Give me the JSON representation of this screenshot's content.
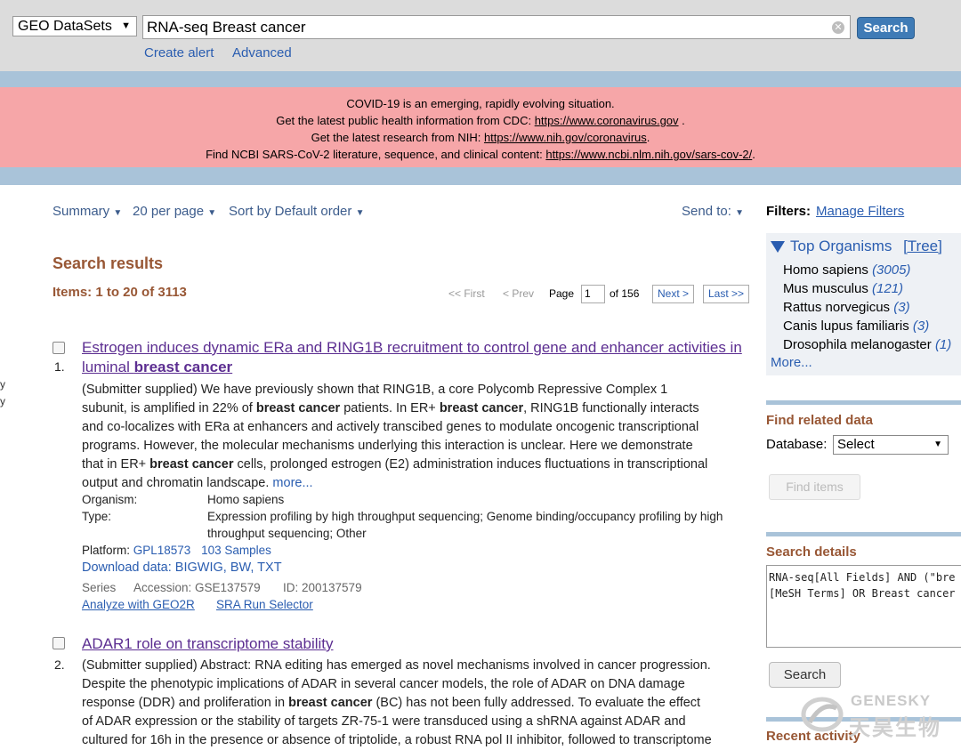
{
  "topbar": {
    "database": "GEO DataSets",
    "query": "RNA-seq Breast cancer",
    "clear_glyph": "✕",
    "search_label": "Search",
    "create_alert": "Create alert",
    "advanced": "Advanced"
  },
  "covid": {
    "line1": "COVID-19 is an emerging, rapidly evolving situation.",
    "line2_text": "Get the latest public health information from CDC: ",
    "line2_link": "https://www.coronavirus.gov",
    "line2_end": " .",
    "line3_text": "Get the latest research from NIH: ",
    "line3_link": "https://www.nih.gov/coronavirus",
    "line3_end": ".",
    "line4_text": "Find NCBI SARS-CoV-2 literature, sequence, and clinical content: ",
    "line4_link": "https://www.ncbi.nlm.nih.gov/sars-cov-2/",
    "line4_end": "."
  },
  "controls": {
    "summary": "Summary",
    "per_page": "20 per page",
    "sort": "Sort by Default order",
    "send_to": "Send to:"
  },
  "results": {
    "title": "Search results",
    "items": "Items: 1 to 20 of 3113"
  },
  "pager": {
    "first": "<< First",
    "prev": "< Prev",
    "page_label": "Page",
    "page_value": "1",
    "of_pages": "of 156",
    "next": "Next >",
    "last": "Last >>"
  },
  "result1": {
    "num": "1.",
    "title_line1": "Estrogen induces dynamic ERa and RING1B recruitment to control gene and enhancer activities in",
    "title_line2a": "luminal ",
    "title_line2b": "breast cancer",
    "a1": "(Submitter supplied) We have previously shown that RING1B, a core Polycomb Repressive Complex 1",
    "a2a": "subunit, is amplified in 22% of ",
    "a2b": "breast cancer",
    "a2c": " patients. In ER+ ",
    "a2d": "breast cancer",
    "a2e": ", RING1B functionally interacts",
    "a3": "and co-localizes with ERa at enhancers and actively transcibed genes to modulate oncogenic transcriptional",
    "a4": "programs. However, the molecular mechanisms underlying this interaction is unclear. Here we demonstrate",
    "a5a": "that in ER+ ",
    "a5b": "breast cancer",
    "a5c": " cells, prolonged estrogen (E2) administration induces fluctuations in transcriptional",
    "a6": "output and chromatin landscape. ",
    "more": "more...",
    "organism_label": "Organism:",
    "organism": "Homo sapiens",
    "type_label": "Type:",
    "type_line1": "Expression profiling by high throughput sequencing; Genome binding/occupancy profiling by high",
    "type_line2": "throughput sequencing; Other",
    "platform_label": "Platform: ",
    "platform": "GPL18573",
    "samples": "103 Samples",
    "download_label": "Download data: ",
    "download": "BIGWIG, BW, TXT",
    "series": "Series",
    "accession": "Accession: GSE137579",
    "id": "ID: 200137579",
    "analyze": "Analyze with GEO2R",
    "sra": "SRA Run Selector"
  },
  "result2": {
    "num": "2.",
    "title": "ADAR1 role on transcriptome stability",
    "a1": "(Submitter supplied) Abstract: RNA editing has emerged as novel mechanisms involved in cancer progression.",
    "a2": "Despite the phenotypic implications of ADAR in several cancer models, the role of ADAR on DNA damage",
    "a3a": "response (DDR) and proliferation in ",
    "a3b": "breast cancer",
    "a3c": " (BC) has not been fully addressed. To evaluate the effect",
    "a4": "of ADAR expression or the stability of targets ZR-75-1 were transduced using a shRNA against ADAR and",
    "a5": "cultured for 16h in the presence or absence of triptolide, a robust RNA pol II inhibitor, followed to transcriptome"
  },
  "sidebar": {
    "filters_label": "Filters:",
    "manage_filters": "Manage Filters",
    "top_organisms": "Top Organisms",
    "tree": "[Tree]",
    "organisms": [
      {
        "name": "Homo sapiens",
        "count": "(3005)"
      },
      {
        "name": "Mus musculus",
        "count": "(121)"
      },
      {
        "name": "Rattus norvegicus",
        "count": "(3)"
      },
      {
        "name": "Canis lupus familiaris",
        "count": "(3)"
      },
      {
        "name": "Drosophila melanogaster",
        "count": "(1)"
      }
    ],
    "more": "More...",
    "find_related": "Find related data",
    "database_label": "Database:",
    "database_value": "Select",
    "find_items": "Find items",
    "search_details": "Search details",
    "details_line1": "RNA-seq[All Fields] AND (\"bre",
    "details_line2": "[MeSH Terms] OR Breast cancer",
    "search_button": "Search",
    "recent_activity": "Recent activity"
  },
  "watermark": {
    "en": "GENESKY",
    "cn": "天昊生物"
  },
  "edge": {
    "a": "y",
    "b": "y"
  }
}
